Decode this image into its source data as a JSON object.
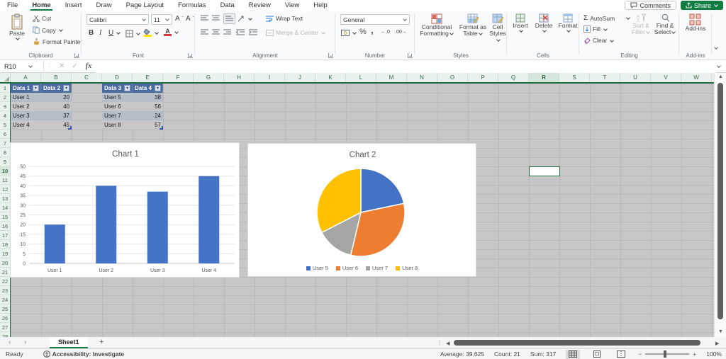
{
  "window": {
    "comments_label": "Comments",
    "share_label": "Share"
  },
  "menu_tabs": {
    "active": "Home",
    "items": [
      "File",
      "Home",
      "Insert",
      "Draw",
      "Page Layout",
      "Formulas",
      "Data",
      "Review",
      "View",
      "Help"
    ]
  },
  "ribbon": {
    "clipboard": {
      "group": "Clipboard",
      "paste": "Paste",
      "cut": "Cut",
      "copy": "Copy",
      "format_painter": "Format Painter"
    },
    "font": {
      "group": "Font",
      "font_name": "Calibri",
      "font_size": "11"
    },
    "alignment": {
      "group": "Alignment",
      "wrap_text": "Wrap Text",
      "merge_center": "Merge & Center"
    },
    "number": {
      "group": "Number",
      "format": "General"
    },
    "styles": {
      "group": "Styles",
      "conditional_1": "Conditional",
      "conditional_2": "Formatting",
      "format_table_1": "Format as",
      "format_table_2": "Table",
      "cell_styles_1": "Cell",
      "cell_styles_2": "Styles"
    },
    "cells": {
      "group": "Cells",
      "insert": "Insert",
      "delete": "Delete",
      "format": "Format"
    },
    "editing": {
      "group": "Editing",
      "autosum": "AutoSum",
      "fill": "Fill",
      "clear": "Clear",
      "sort_1": "Sort &",
      "sort_2": "Filter",
      "find_1": "Find &",
      "find_2": "Select"
    },
    "addins": {
      "group": "Add-ins",
      "button": "Add-ins"
    }
  },
  "formula_bar": {
    "name_box": "R10",
    "formula": "",
    "fx": "fx"
  },
  "grid": {
    "columns": [
      "A",
      "B",
      "C",
      "D",
      "E",
      "F",
      "G",
      "H",
      "I",
      "J",
      "K",
      "L",
      "M",
      "N",
      "O",
      "P",
      "Q",
      "R",
      "S",
      "T",
      "U",
      "V",
      "W"
    ],
    "rows": 28,
    "selected_cell": "R10",
    "selected_col": "R",
    "selected_row": 10
  },
  "tables": [
    {
      "headers": [
        "Data 1",
        "Data 2"
      ],
      "start_col": 0,
      "rows": [
        [
          "User 1",
          "20"
        ],
        [
          "User 2",
          "40"
        ],
        [
          "User 3",
          "37"
        ],
        [
          "User 4",
          "45"
        ]
      ]
    },
    {
      "headers": [
        "Data 3",
        "Data 4"
      ],
      "start_col": 3,
      "rows": [
        [
          "User 5",
          "38"
        ],
        [
          "User 6",
          "56"
        ],
        [
          "User 7",
          "24"
        ],
        [
          "User 8",
          "57"
        ]
      ]
    }
  ],
  "chart_data": [
    {
      "type": "bar",
      "title": "Chart 1",
      "categories": [
        "User 1",
        "User 2",
        "User 3",
        "User 4"
      ],
      "values": [
        20,
        40,
        37,
        45
      ],
      "ylim": [
        0,
        50
      ],
      "ytick_step": 5,
      "grid": true,
      "bar_color": "#4472C4",
      "xlabel": "",
      "ylabel": ""
    },
    {
      "type": "pie",
      "title": "Chart 2",
      "labels": [
        "User 5",
        "User 6",
        "User 7",
        "User 8"
      ],
      "values": [
        38,
        56,
        24,
        57
      ],
      "colors": [
        "#4472C4",
        "#ED7D31",
        "#A5A5A5",
        "#FFC000"
      ],
      "legend_position": "bottom"
    }
  ],
  "sheet_bar": {
    "active_tab": "Sheet1"
  },
  "status_bar": {
    "mode": "Ready",
    "accessibility": "Accessibility: Investigate",
    "average": "Average: 39.625",
    "count": "Count: 21",
    "sum": "Sum: 317",
    "zoom_level": "100%"
  },
  "colors": {
    "excel_green": "#107C41",
    "table_header_blue": "#4a6aa0",
    "sheet_gray": "#c7c7c7"
  }
}
